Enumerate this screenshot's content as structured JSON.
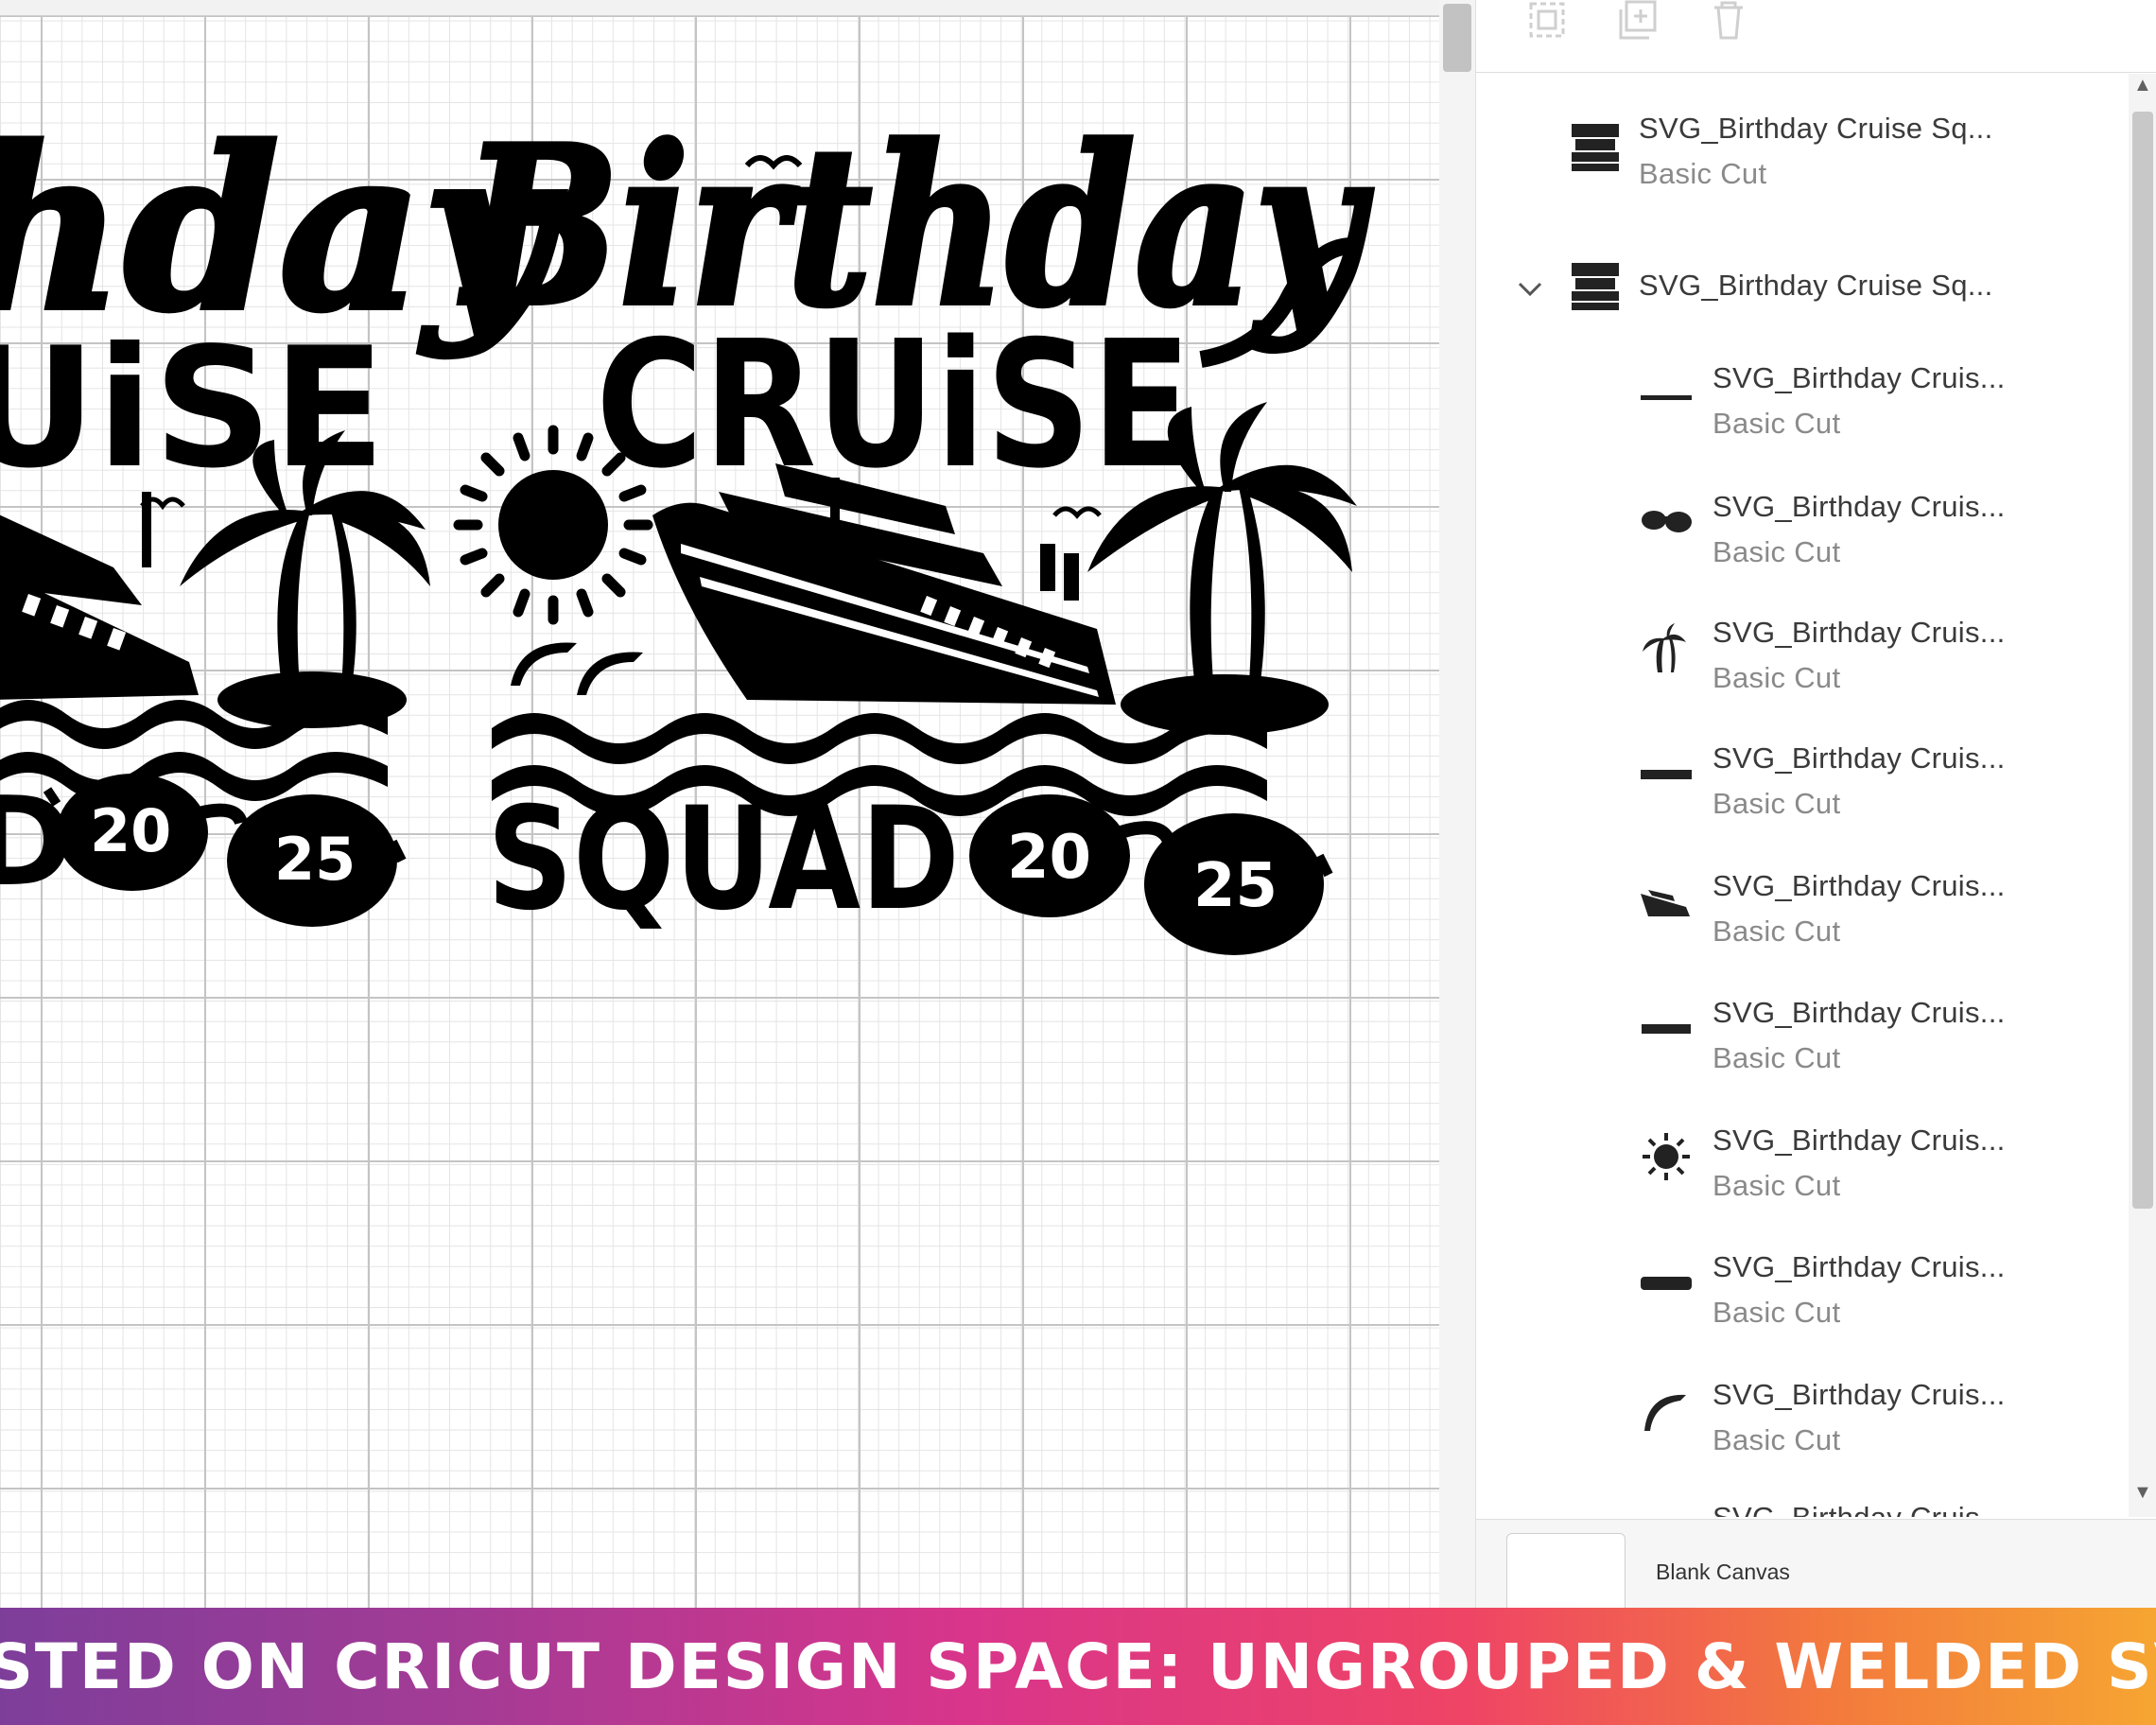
{
  "canvas": {
    "design": {
      "left_copy": {
        "line1": "hday",
        "line2": "UiSE",
        "squad": "D",
        "year_left": "20",
        "year_right": "25"
      },
      "right_copy": {
        "line1": "Birthday",
        "line2": "CRUiSE",
        "squad": "SQUAD",
        "year_left": "20",
        "year_right": "25"
      }
    }
  },
  "panel": {
    "toolbar": {
      "icons": [
        "group-icon",
        "duplicate-icon",
        "delete-icon"
      ]
    },
    "layers": [
      {
        "name": "SVG_Birthday Cruise Sq...",
        "operation": "Basic Cut",
        "thumb": "full-design-thumb"
      },
      {
        "name": "SVG_Birthday Cruise Sq...",
        "operation": "",
        "thumb": "full-design-thumb",
        "expanded": true
      },
      {
        "name": "SVG_Birthday Cruis...",
        "operation": "Basic Cut",
        "thumb": "line-thumb"
      },
      {
        "name": "SVG_Birthday Cruis...",
        "operation": "Basic Cut",
        "thumb": "sunglasses-thumb"
      },
      {
        "name": "SVG_Birthday Cruis...",
        "operation": "Basic Cut",
        "thumb": "palm-trees-thumb"
      },
      {
        "name": "SVG_Birthday Cruis...",
        "operation": "Basic Cut",
        "thumb": "cruise-word-thumb"
      },
      {
        "name": "SVG_Birthday Cruis...",
        "operation": "Basic Cut",
        "thumb": "ship-thumb"
      },
      {
        "name": "SVG_Birthday Cruis...",
        "operation": "Basic Cut",
        "thumb": "squad-word-thumb"
      },
      {
        "name": "SVG_Birthday Cruis...",
        "operation": "Basic Cut",
        "thumb": "sun-thumb"
      },
      {
        "name": "SVG_Birthday Cruis...",
        "operation": "Basic Cut",
        "thumb": "birthday-word-thumb"
      },
      {
        "name": "SVG_Birthday Cruis...",
        "operation": "Basic Cut",
        "thumb": "dolphin-thumb"
      },
      {
        "name": "SVG_Birthday Cruis...",
        "operation": "",
        "thumb": ""
      }
    ],
    "canvas_label": "Blank Canvas"
  },
  "banner": {
    "text": "TESTED ON CRICUT DESIGN SPACE: UNGROUPED & WELDED SVG"
  },
  "colors": {
    "ink": "#000000",
    "banner_start": "#7d3e9a",
    "banner_end": "#f6a532"
  }
}
